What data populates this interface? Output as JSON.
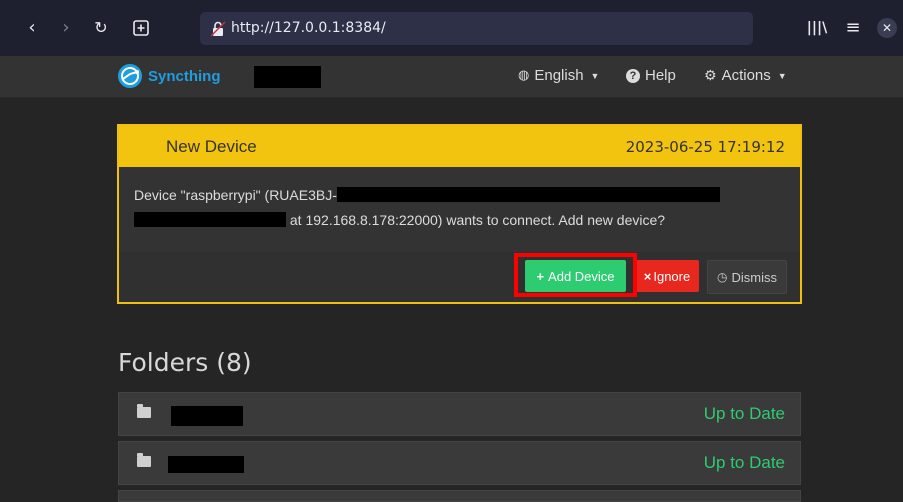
{
  "browser": {
    "url": "http://127.0.0.1:8384/",
    "icons": [
      "back-icon",
      "forward-icon",
      "reload-icon",
      "new-tab-icon",
      "lock-icon",
      "library-icon",
      "menu-icon",
      "close-icon"
    ]
  },
  "app": {
    "brand": "Syncthing",
    "nav": {
      "language": "English",
      "help": "Help",
      "actions": "Actions"
    }
  },
  "notification": {
    "title": "New Device",
    "timestamp": "2023-06-25 17:19:12",
    "message_part1": "Device \"raspberrypi\" (RUAE3BJ-",
    "message_part2": "at 192.168.8.178:22000) wants to connect. Add new device?",
    "buttons": {
      "add": "Add Device",
      "ignore": "Ignore",
      "dismiss": "Dismiss"
    }
  },
  "folders": {
    "title": "Folders (8)",
    "rows": [
      {
        "status": "Up to Date"
      },
      {
        "status": "Up to Date"
      }
    ]
  },
  "colors": {
    "accent_yellow": "#f2c40f",
    "success_green": "#2ecc71",
    "danger_red": "#e8271e",
    "brand_blue": "#1e9ee0"
  }
}
